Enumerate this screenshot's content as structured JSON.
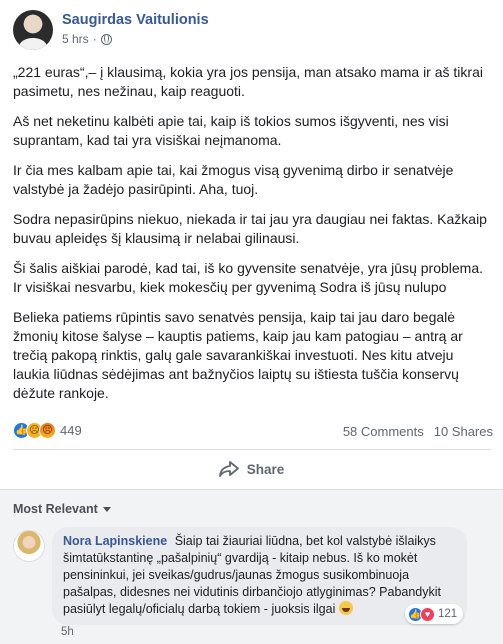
{
  "post": {
    "author": "Saugirdas Vaitulionis",
    "time": "5 hrs",
    "separator": "·",
    "privacy_icon": "globe-icon",
    "paragraphs": [
      "„221 euras“,– į klausimą, kokia yra jos pensija, man atsako mama ir aš tikrai pasimetu, nes nežinau, kaip reaguoti.",
      "Aš net neketinu kalbėti apie tai, kaip iš tokios sumos išgyventi, nes visi suprantam, kad tai yra visiškai neįmanoma.",
      "Ir čia mes kalbam apie tai, kai žmogus visą gyvenimą dirbo ir senatvėje valstybė ja žadėjo pasirūpinti. Aha, tuoj.",
      "Sodra nepasirūpins niekuo, niekada ir tai jau yra daugiau nei faktas. Kažkaip buvau apleidęs šį klausimą ir nelabai gilinausi.",
      "Ši šalis aiškiai parodė, kad tai, iš ko gyvensite senatvėje, yra jūsų problema. Ir visiškai nesvarbu, kiek mokesčių per gyvenimą Sodra iš jūsų nulupo",
      "Belieka patiems rūpintis savo senatvės pensija, kaip tai jau daro begalė žmonių kitose šalyse – kauptis patiems, kaip jau kam patogiau – antrą ar trečią pakopą rinktis, galų gale savarankiškai investuoti. Nes kitu atveju laukia liūdnas sėdėjimas ant bažnyčios laiptų su ištiesta tuščia konservų dėžute rankoje."
    ],
    "reaction_count": "449",
    "reaction_icons": [
      "like-icon",
      "sad-icon",
      "angry-icon"
    ],
    "comments_count": "58 Comments",
    "shares_count": "10 Shares",
    "share_label": "Share"
  },
  "comments_section": {
    "sort_label": "Most Relevant",
    "comment": {
      "author": "Nora Lapinskiene",
      "text": "Šiaip tai žiauriai liūdna, bet kol valstybė išlaikys šimtatūkstantinę „pašalpinių“ gvardiją - kitaip nebus. Iš ko mokėt pensininkui, jei sveikas/gudrus/jaunas žmogus susikombinuoja pašalpas, didesnes nei vidutinis dirbančiojo atlyginimas? Pabandykit pasiūlyt legalų/oficialų darbą tokiem - juoksis ilgai",
      "reaction_count": "121",
      "reaction_icons": [
        "like-icon",
        "love-icon"
      ],
      "time": "5h"
    }
  },
  "colors": {
    "link": "#385898",
    "like": "#1877f2",
    "love": "#f33e58",
    "comments_bg": "#f2f3f5"
  }
}
